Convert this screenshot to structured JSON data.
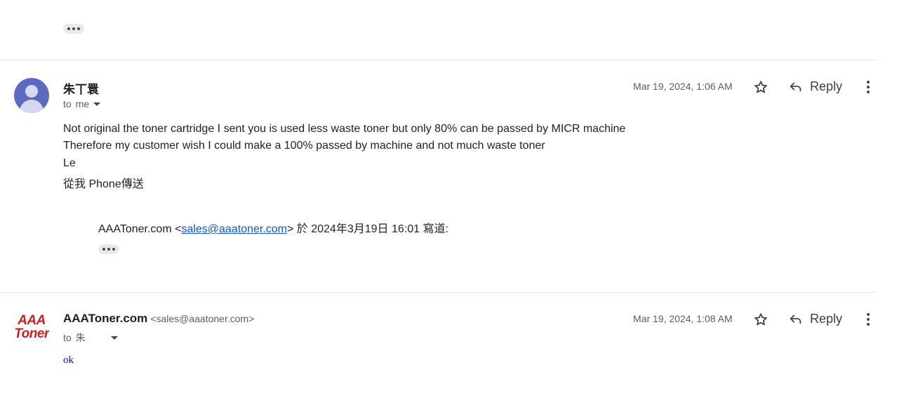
{
  "messages": [
    {
      "sender_name": "朱丅睘",
      "recipient_prefix": "to",
      "recipient": "me",
      "date": "Mar 19, 2024, 1:06 AM",
      "reply_label": "Reply",
      "body_lines": [
        "Not original the toner cartridge I sent you is used less waste toner but only 80% can be passed by MICR machine",
        "Therefore my customer wish I could make a 100% passed by machine and not much waste toner",
        "Le",
        "從我    Phone傳送"
      ],
      "quote": {
        "name": "AAAToner.com",
        "open": "<",
        "email": "sales@aaatoner.com",
        "close": ">",
        "rest": " 於 2024年3月19日 16:01 寫道:"
      }
    },
    {
      "sender_name": "AAAToner.com",
      "sender_email": "<sales@aaatoner.com>",
      "recipient_prefix": "to",
      "recipient": "朱",
      "date": "Mar 19, 2024, 1:08 AM",
      "reply_label": "Reply",
      "body": "ok",
      "logo_text": [
        "AAA",
        "Toner"
      ]
    }
  ],
  "colors": {
    "avatar_bg": "#5c6bc0",
    "logo_red": "#cc1f1f",
    "link_blue": "#1155cc",
    "ok_blue": "#0000ff"
  }
}
